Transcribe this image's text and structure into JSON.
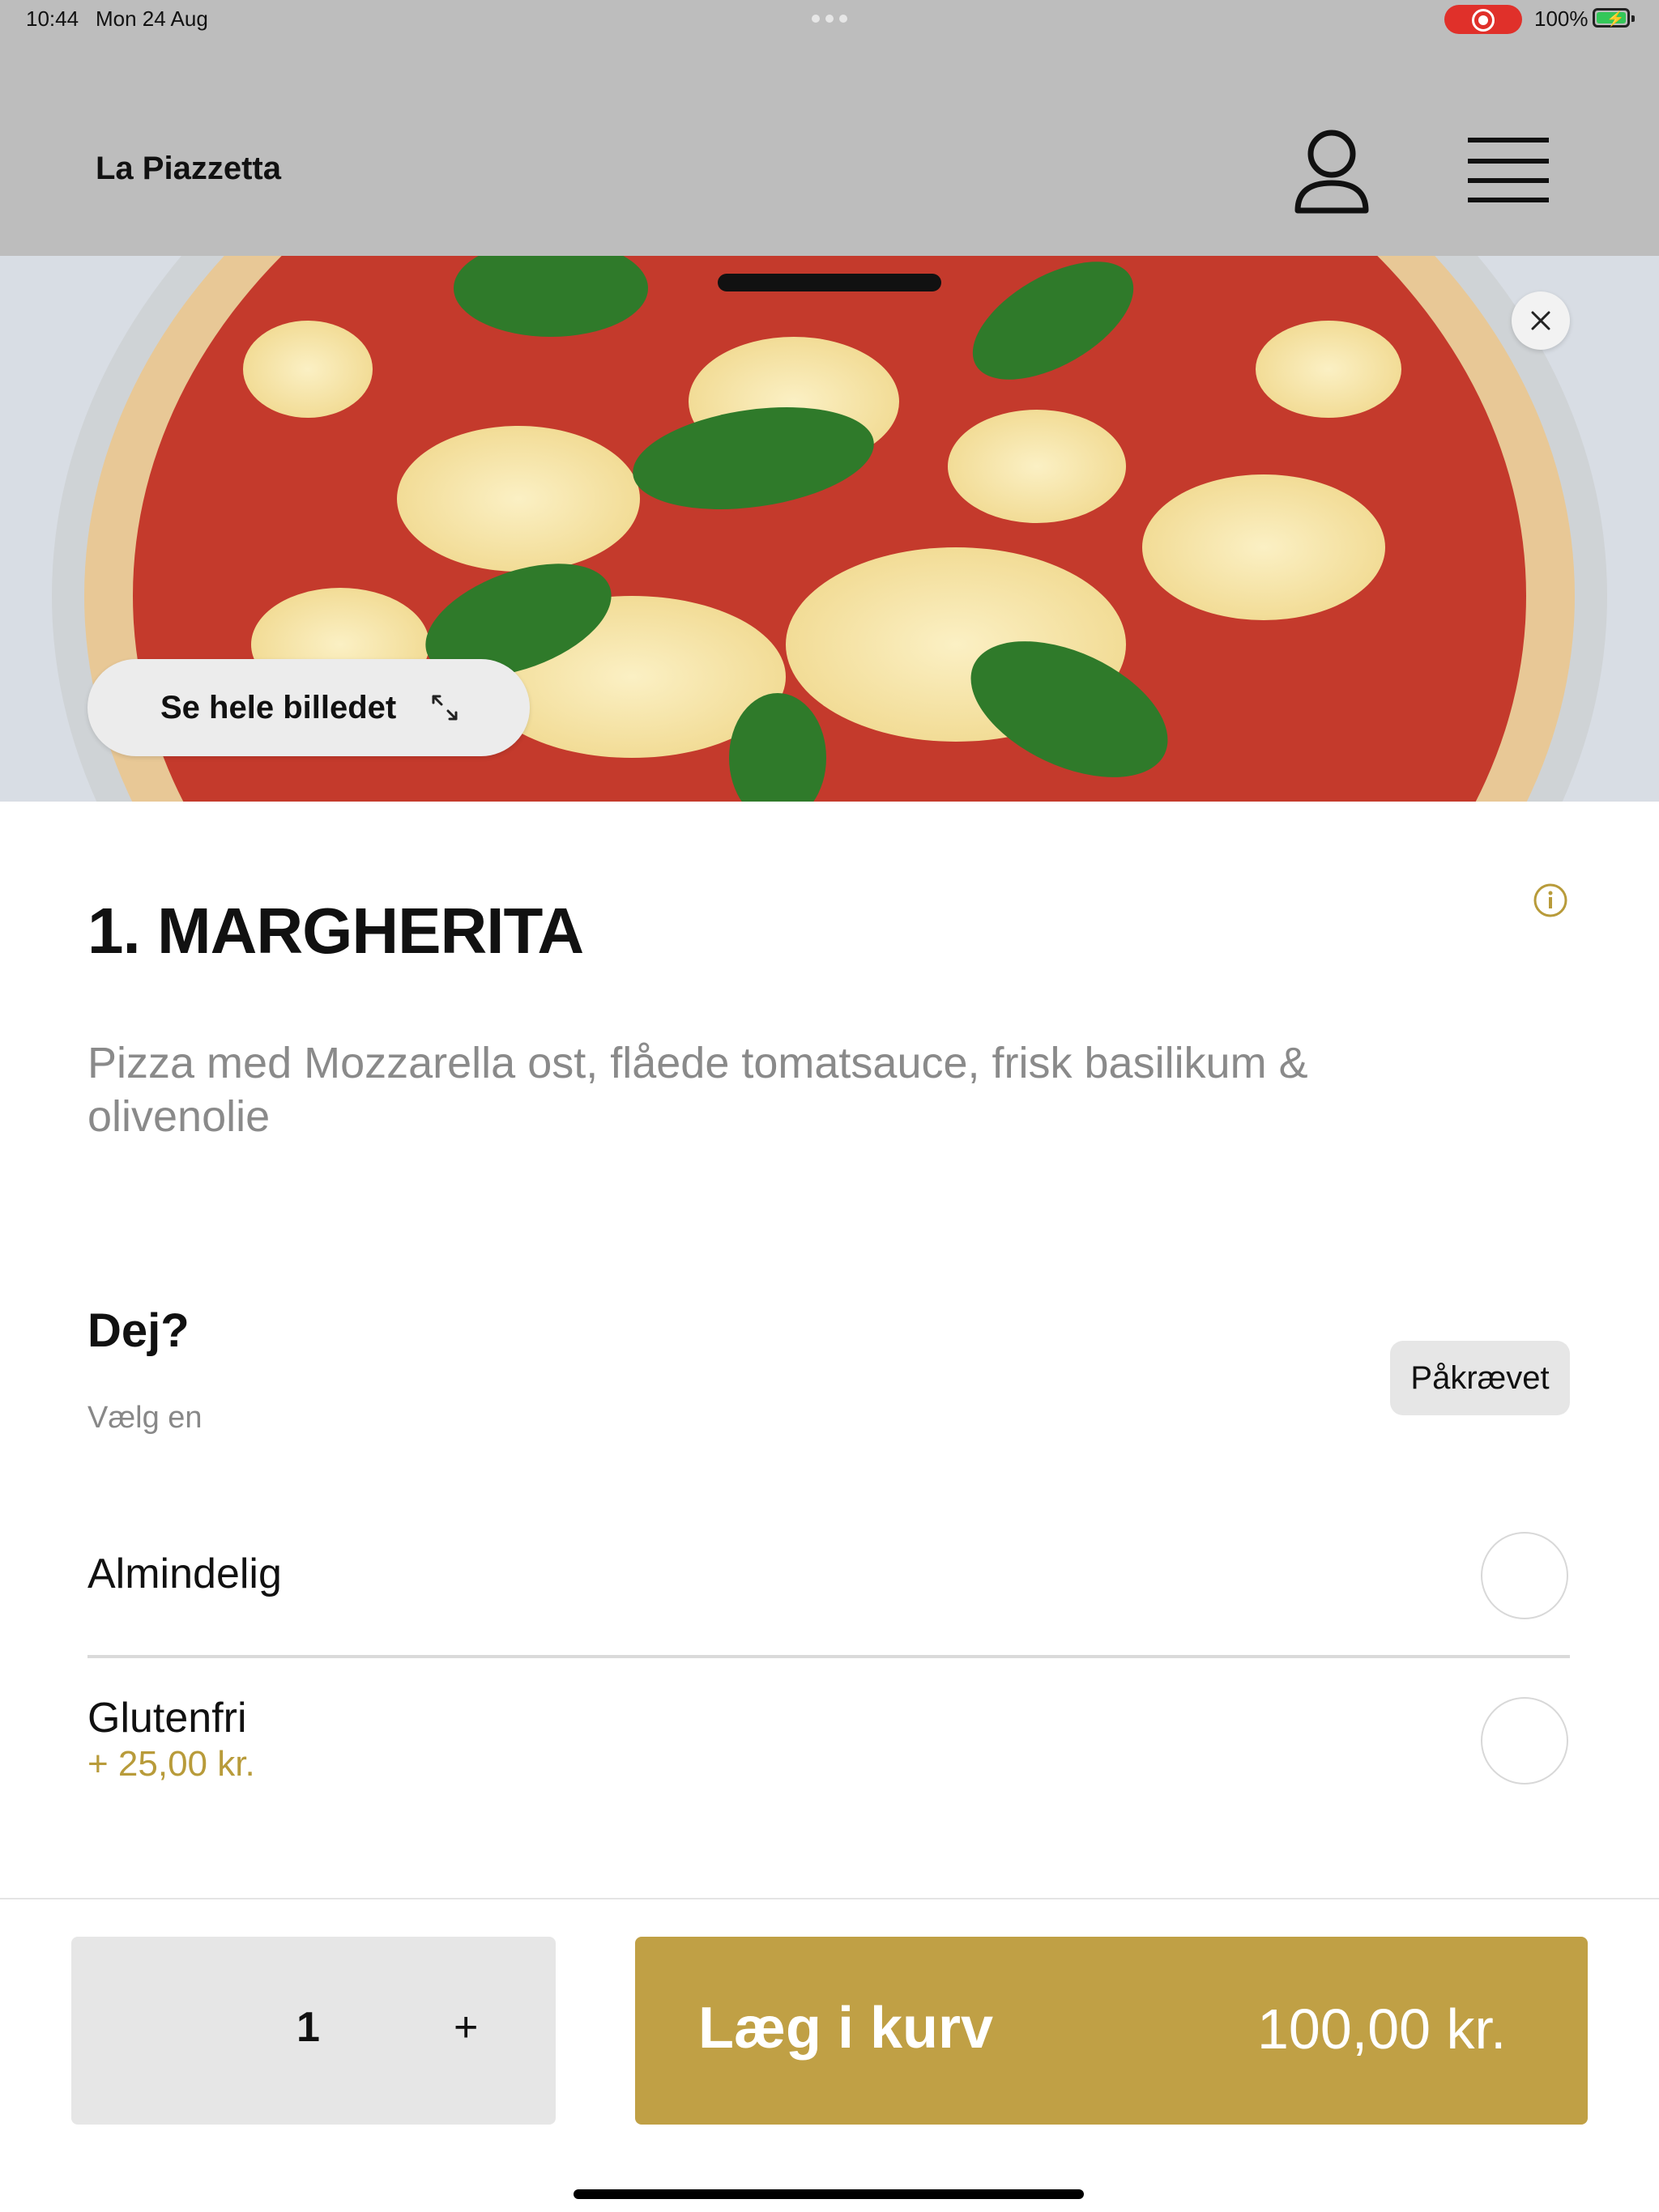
{
  "status_bar": {
    "time": "10:44",
    "date": "Mon 24 Aug",
    "battery": "100%"
  },
  "header": {
    "brand": "La Piazzetta",
    "icons": [
      "user-icon",
      "menu-icon"
    ]
  },
  "hero": {
    "see_image_label": "Se hele billedet"
  },
  "product": {
    "title": "1. MARGHERITA",
    "description": "Pizza med Mozzarella ost, flåede tomatsauce, frisk basilikum & olivenolie"
  },
  "options_group": {
    "title": "Dej?",
    "subtitle": "Vælg en",
    "required_badge": "Påkrævet",
    "options": [
      {
        "label": "Almindelig",
        "price": ""
      },
      {
        "label": "Glutenfri",
        "price": "+ 25,00 kr."
      }
    ]
  },
  "footer": {
    "quantity": "1",
    "plus": "+",
    "add_to_cart": "Læg i kurv",
    "total": "100,00 kr."
  },
  "colors": {
    "accent": "#c0a045",
    "header_bg": "#bdbdbd",
    "recording": "#e0302a"
  }
}
